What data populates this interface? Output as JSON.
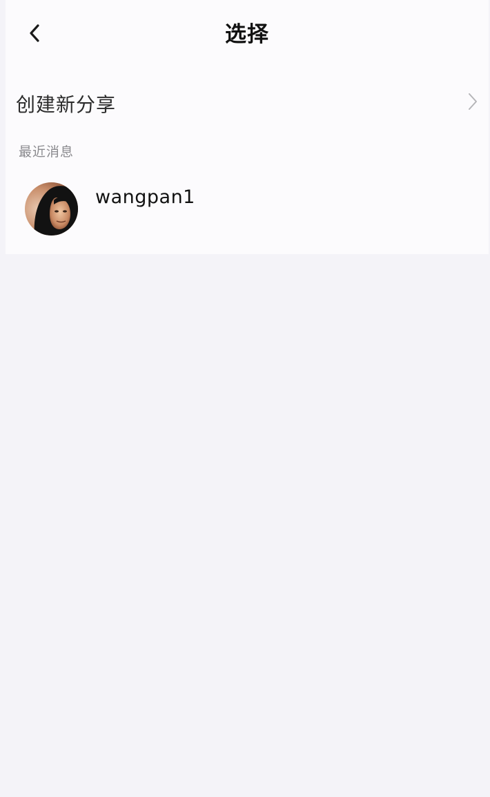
{
  "header": {
    "back_icon": "chevron-left-icon",
    "title": "选择"
  },
  "create_share": {
    "label": "创建新分享",
    "chevron_icon": "chevron-right-icon"
  },
  "recent": {
    "section_title": "最近消息",
    "contacts": [
      {
        "name": "wangpan1",
        "avatar": "user-avatar"
      }
    ]
  },
  "colors": {
    "background": "#f4f3f8",
    "panel": "#fcfbfd",
    "title_text": "#111111",
    "secondary_text": "#8a8a8e",
    "chevron": "#b5b5b8"
  }
}
